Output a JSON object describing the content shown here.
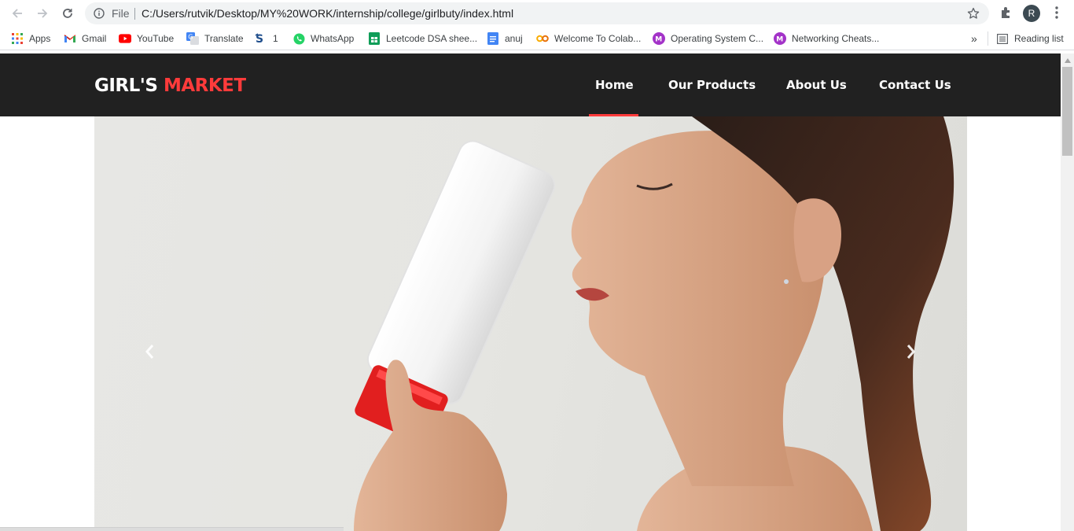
{
  "browser": {
    "file_label": "File",
    "url": "C:/Users/rutvik/Desktop/MY%20WORK/internship/college/girlbuty/index.html",
    "profile_initial": "R",
    "bookmarks": [
      {
        "label": "Apps",
        "icon": "apps-grid-icon"
      },
      {
        "label": "Gmail",
        "icon": "gmail-icon"
      },
      {
        "label": "YouTube",
        "icon": "youtube-icon"
      },
      {
        "label": "Translate",
        "icon": "translate-icon"
      },
      {
        "label": "1",
        "icon": "s-logo-icon"
      },
      {
        "label": "WhatsApp",
        "icon": "whatsapp-icon"
      },
      {
        "label": "Leetcode DSA shee...",
        "icon": "sheets-icon"
      },
      {
        "label": "anuj",
        "icon": "docs-icon"
      },
      {
        "label": "Welcome To Colab...",
        "icon": "colab-icon"
      },
      {
        "label": "Operating System C...",
        "icon": "m-circle-icon"
      },
      {
        "label": "Networking Cheats...",
        "icon": "m-circle-icon"
      }
    ],
    "overflow_label": "»",
    "reading_list_label": "Reading list"
  },
  "site": {
    "logo_main": "GIRL'S",
    "logo_accent": "MARKET",
    "nav": [
      {
        "label": "Home",
        "active": true
      },
      {
        "label": "Our Products",
        "active": false
      },
      {
        "label": "About Us",
        "active": false
      },
      {
        "label": "Contact Us",
        "active": false
      }
    ],
    "hero": {
      "image": "woman-holding-cosmetic-tube-photo",
      "prev_icon": "chevron-left-icon",
      "next_icon": "chevron-right-icon"
    }
  },
  "colors": {
    "header_bg": "#212121",
    "accent": "#ff3b3b",
    "nav_text": "#ffffff"
  }
}
